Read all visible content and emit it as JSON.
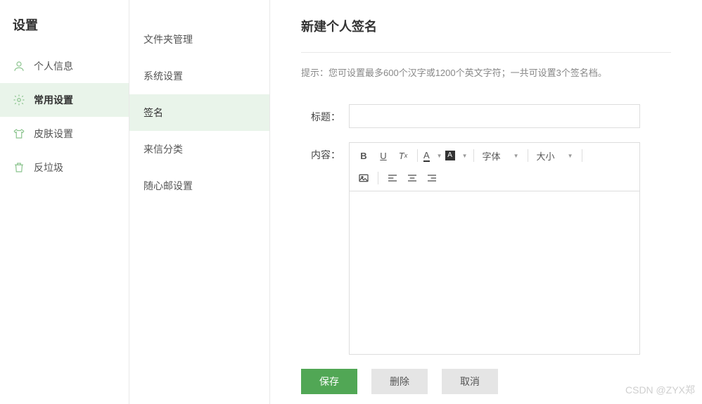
{
  "sidebar": {
    "title": "设置",
    "items": [
      {
        "label": "个人信息"
      },
      {
        "label": "常用设置"
      },
      {
        "label": "皮肤设置"
      },
      {
        "label": "反垃圾"
      }
    ]
  },
  "subnav": {
    "items": [
      {
        "label": "文件夹管理"
      },
      {
        "label": "系统设置"
      },
      {
        "label": "签名"
      },
      {
        "label": "来信分类"
      },
      {
        "label": "随心邮设置"
      }
    ]
  },
  "main": {
    "title": "新建个人签名",
    "hint": "提示：您可设置最多600个汉字或1200个英文字符；一共可设置3个签名档。",
    "form": {
      "title_label": "标题：",
      "content_label": "内容：",
      "title_value": ""
    },
    "toolbar": {
      "bold": "B",
      "underline": "U",
      "clear_format": "Tx",
      "text_color": "A",
      "bg_color": "A",
      "font_label": "字体",
      "size_label": "大小"
    },
    "buttons": {
      "save": "保存",
      "delete": "删除",
      "cancel": "取消"
    }
  },
  "watermark": "CSDN @ZYX郑"
}
